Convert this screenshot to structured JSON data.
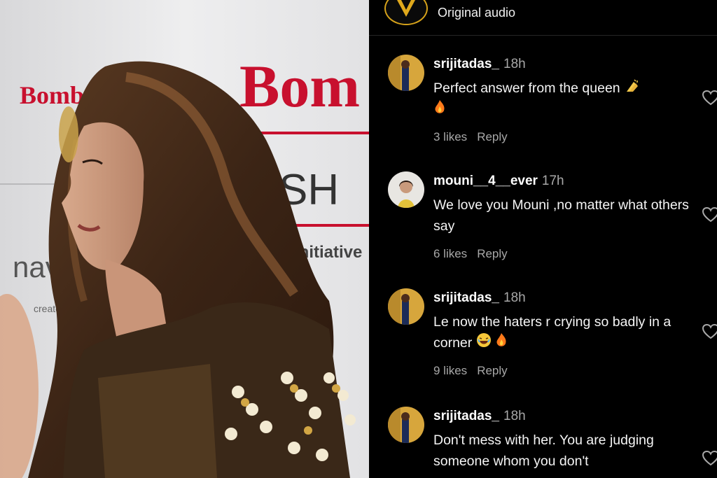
{
  "header": {
    "title": "",
    "audio_label": "Original audio"
  },
  "photo": {
    "backdrop_text": [
      "Bomb",
      "Bom",
      "SH",
      "Initiative",
      "navy",
      "created b"
    ]
  },
  "comments": [
    {
      "username": "srijitadas_",
      "time": "18h",
      "text": "Perfect answer from the queen",
      "likes": "3 likes",
      "reply": "Reply",
      "emoji": [
        "clapping-hands",
        "fire"
      ]
    },
    {
      "username": "mouni__4__ever",
      "time": "17h",
      "text": "We love you Mouni ,no matter what others say",
      "likes": "6 likes",
      "reply": "Reply",
      "emoji": []
    },
    {
      "username": "srijitadas_",
      "time": "18h",
      "text": "Le now the haters r crying so badly in a corner",
      "likes": "9 likes",
      "reply": "Reply",
      "emoji": [
        "laughing-face",
        "fire"
      ]
    },
    {
      "username": "srijitadas_",
      "time": "18h",
      "text": "Don't mess with her. You are judging someone whom you don't",
      "likes": "",
      "reply": "",
      "emoji": []
    }
  ],
  "colors": {
    "background": "#000000",
    "muted": "#a8a8a8",
    "brand_red": "#c8102e"
  }
}
